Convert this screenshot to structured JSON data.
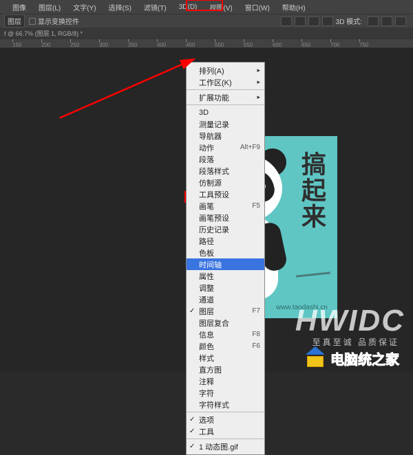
{
  "menubar": {
    "items": [
      {
        "label": "图像"
      },
      {
        "label": "图层(L)"
      },
      {
        "label": "文字(Y)"
      },
      {
        "label": "选择(S)"
      },
      {
        "label": "滤镜(T)"
      },
      {
        "label": "3D(D)"
      },
      {
        "label": "视图(V)"
      },
      {
        "label": "窗口(W)"
      },
      {
        "label": "帮助(H)"
      }
    ]
  },
  "toolbar": {
    "layer_btn": "图层",
    "show_controls": "显示变换控件",
    "mode_label": "3D 模式:"
  },
  "tab": {
    "title": "f @ 66.7% (图层 1, RGB/8) *"
  },
  "ruler": {
    "ticks": [
      "150",
      "200",
      "250",
      "300",
      "350",
      "400",
      "450",
      "500",
      "550",
      "600",
      "650",
      "700",
      "750"
    ]
  },
  "window_menu": {
    "arrange": "排列(A)",
    "workspace": "工作区(K)",
    "extensions": "扩展功能",
    "items": [
      {
        "label": "3D"
      },
      {
        "label": "测量记录"
      },
      {
        "label": "导航器"
      },
      {
        "label": "动作",
        "shortcut": "Alt+F9"
      },
      {
        "label": "段落"
      },
      {
        "label": "段落样式"
      },
      {
        "label": "仿制源"
      },
      {
        "label": "工具预设"
      },
      {
        "label": "画笔",
        "shortcut": "F5"
      },
      {
        "label": "画笔预设"
      },
      {
        "label": "历史记录"
      },
      {
        "label": "路径"
      },
      {
        "label": "色板"
      },
      {
        "label": "时间轴",
        "highlight": true
      },
      {
        "label": "属性"
      },
      {
        "label": "调整"
      },
      {
        "label": "通道"
      },
      {
        "label": "图层",
        "shortcut": "F7",
        "check": true
      },
      {
        "label": "图层复合"
      },
      {
        "label": "信息",
        "shortcut": "F8"
      },
      {
        "label": "颜色",
        "shortcut": "F6"
      },
      {
        "label": "样式"
      },
      {
        "label": "直方图"
      },
      {
        "label": "注释"
      },
      {
        "label": "字符"
      },
      {
        "label": "字符样式"
      }
    ],
    "options": "选项",
    "tools": "工具",
    "doc": "1 动态图.gif"
  },
  "artwork": {
    "text": "搞起来",
    "url": "www.taodashi.cn"
  },
  "watermark": {
    "main": "HWIDC",
    "sub": "至真至诚 品质保证",
    "badge": "电脑统之家"
  }
}
